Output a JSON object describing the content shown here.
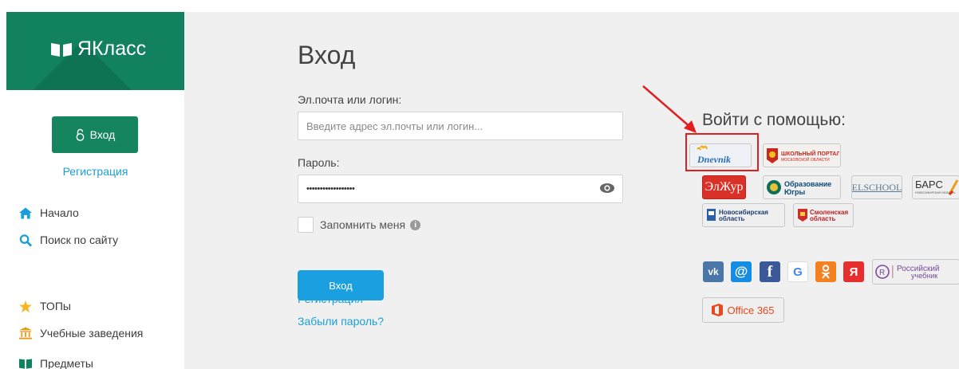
{
  "sidebar": {
    "logo_text": "ЯКласс",
    "login_button": "Вход",
    "register_link": "Регистрация",
    "nav": [
      {
        "label": "Начало",
        "icon": "home-icon"
      },
      {
        "label": "Поиск по сайту",
        "icon": "search-icon"
      },
      {
        "label": "ТОПы",
        "icon": "star-icon"
      },
      {
        "label": "Учебные заведения",
        "icon": "school-building-icon"
      },
      {
        "label": "Предметы",
        "icon": "book-icon"
      }
    ]
  },
  "main": {
    "title": "Вход",
    "login_label": "Эл.почта или логин:",
    "login_placeholder": "Введите адрес эл.почты или логин...",
    "password_label": "Пароль:",
    "password_value": "••••••••••••••••••",
    "remember_label": "Запомнить меня",
    "submit_button": "Вход",
    "register_link": "Регистрация",
    "forgot_link": "Забыли пароль?"
  },
  "providers": {
    "title": "Войти с помощью:",
    "items": [
      {
        "name": "Dnevnik",
        "label": "Dnevnik"
      },
      {
        "name": "school-portal",
        "label_line1": "ШКОЛЬНЫЙ ПОРТАЛ",
        "label_line2": "МОСКОВСКОЙ ОБЛАСТИ"
      },
      {
        "name": "eljur",
        "label": "ЭлЖур"
      },
      {
        "name": "ugra",
        "label_line1": "Образование",
        "label_line2": "Югры"
      },
      {
        "name": "elschool",
        "label": "ELSCHOOL"
      },
      {
        "name": "bars",
        "label": "БАРС",
        "sub": "НОВОСИБИРСКАЯ ОБЛАСТЬ"
      },
      {
        "name": "novosibirsk",
        "label_line1": "Новосибирская",
        "label_line2": "область"
      },
      {
        "name": "smolensk",
        "label_line1": "Смоленская",
        "label_line2": "область"
      }
    ],
    "social": [
      {
        "name": "vk",
        "label": "vk",
        "color": "#4a76a8"
      },
      {
        "name": "mail",
        "label": "@",
        "color": "#168de2"
      },
      {
        "name": "facebook",
        "label": "f",
        "color": "#3b5998"
      },
      {
        "name": "google",
        "label": "G",
        "color": "#ffffff"
      },
      {
        "name": "odnoklassniki",
        "label": "ok",
        "color": "#f4811f"
      },
      {
        "name": "yandex",
        "label": "Я",
        "color": "#e62e2e"
      }
    ],
    "ru_textbook_line1": "Российский",
    "ru_textbook_line2": "учебник",
    "office_label": "Office 365"
  },
  "colors": {
    "brand_green": "#11815f",
    "link_blue": "#1a9fd8",
    "button_blue": "#1a9fe0",
    "highlight_red": "#e02020"
  }
}
